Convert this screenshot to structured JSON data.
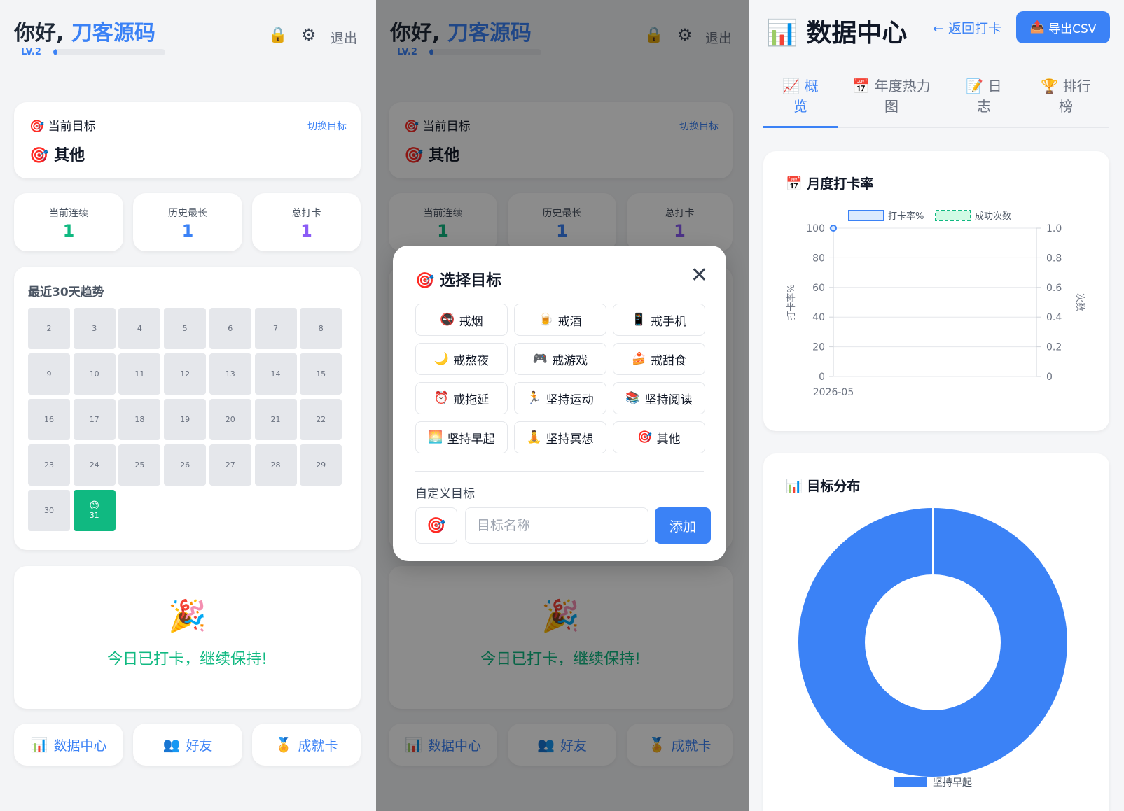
{
  "colors": {
    "accent": "#3b82f6",
    "success": "#10b981",
    "purple": "#8b5cf6",
    "streak": "#10b981"
  },
  "home": {
    "greeting": "你好,",
    "username": "刀客源码",
    "level": "LV.2",
    "level_progress": 0.03,
    "lock_icon": "🔒",
    "gear_icon": "⚙",
    "logout": "退出",
    "current_goal_label": "当前目标",
    "switch_goal": "切换目标",
    "current_goal_icon": "🎯",
    "current_goal": "其他",
    "stats": [
      {
        "label": "当前连续",
        "value": "1",
        "color": "#10b981"
      },
      {
        "label": "历史最长",
        "value": "1",
        "color": "#3b82f6"
      },
      {
        "label": "总打卡",
        "value": "1",
        "color": "#8b5cf6"
      }
    ],
    "trend_title": "最近30天趋势",
    "days": [
      "2",
      "3",
      "4",
      "5",
      "6",
      "7",
      "8",
      "9",
      "10",
      "11",
      "12",
      "13",
      "14",
      "15",
      "16",
      "17",
      "18",
      "19",
      "20",
      "21",
      "22",
      "23",
      "24",
      "25",
      "26",
      "27",
      "28",
      "29",
      "30",
      "31"
    ],
    "done_day": "31",
    "done_face": "😊",
    "celebrate_icon": "🎉",
    "checked_in_message": "今日已打卡，继续保持!",
    "nav": [
      {
        "icon": "📊",
        "label": "数据中心"
      },
      {
        "icon": "👥",
        "label": "好友"
      },
      {
        "icon": "🏅",
        "label": "成就卡"
      }
    ]
  },
  "modal": {
    "title_icon": "🎯",
    "title": "选择目标",
    "close": "✕",
    "options": [
      {
        "icon": "🚭",
        "label": "戒烟"
      },
      {
        "icon": "🍺",
        "label": "戒酒"
      },
      {
        "icon": "📱",
        "label": "戒手机"
      },
      {
        "icon": "🌙",
        "label": "戒熬夜"
      },
      {
        "icon": "🎮",
        "label": "戒游戏"
      },
      {
        "icon": "🍰",
        "label": "戒甜食"
      },
      {
        "icon": "⏰",
        "label": "戒拖延"
      },
      {
        "icon": "🏃",
        "label": "坚持运动"
      },
      {
        "icon": "📚",
        "label": "坚持阅读"
      },
      {
        "icon": "🌅",
        "label": "坚持早起"
      },
      {
        "icon": "🧘",
        "label": "坚持冥想"
      },
      {
        "icon": "🎯",
        "label": "其他"
      }
    ],
    "custom_label": "自定义目标",
    "custom_emoji": "🎯",
    "custom_placeholder": "目标名称",
    "add": "添加"
  },
  "data_center": {
    "title_icon": "📊",
    "title": "数据中心",
    "back": "← 返回打卡",
    "export_icon": "📤",
    "export": "导出CSV",
    "tabs": [
      {
        "icon": "📈",
        "line1": "概",
        "line2": "览",
        "active": true
      },
      {
        "icon": "📅",
        "line1": "年度热力",
        "line2": "图",
        "active": false
      },
      {
        "icon": "📝",
        "line1": "日",
        "line2": "志",
        "active": false
      },
      {
        "icon": "🏆",
        "line1": "排行",
        "line2": "榜",
        "active": false
      }
    ],
    "monthly_title_icon": "📅",
    "monthly_title": "月度打卡率",
    "donut_title_icon": "📊",
    "donut_title": "目标分布"
  },
  "chart_data": [
    {
      "type": "line",
      "title": "月度打卡率",
      "x": [
        "2026-05"
      ],
      "series": [
        {
          "name": "打卡率%",
          "axis": "left",
          "values": [
            100
          ],
          "color": "#3b82f6"
        },
        {
          "name": "成功次数",
          "axis": "right",
          "values": [
            0
          ],
          "color": "#10b981",
          "dashed": true
        }
      ],
      "ylabel": "打卡率%",
      "y2label": "次数",
      "ylim": [
        0,
        100
      ],
      "y2lim": [
        0,
        1
      ],
      "yticks": [
        "0",
        "20",
        "40",
        "60",
        "80",
        "100"
      ],
      "y2ticks": [
        "0",
        "0.2",
        "0.4",
        "0.6",
        "0.8",
        "1.0"
      ],
      "legend": "top-center"
    },
    {
      "type": "pie",
      "title": "目标分布",
      "categories": [
        "坚持早起"
      ],
      "values": [
        1
      ],
      "colors": [
        "#3b82f6"
      ],
      "legend": "bottom"
    }
  ]
}
